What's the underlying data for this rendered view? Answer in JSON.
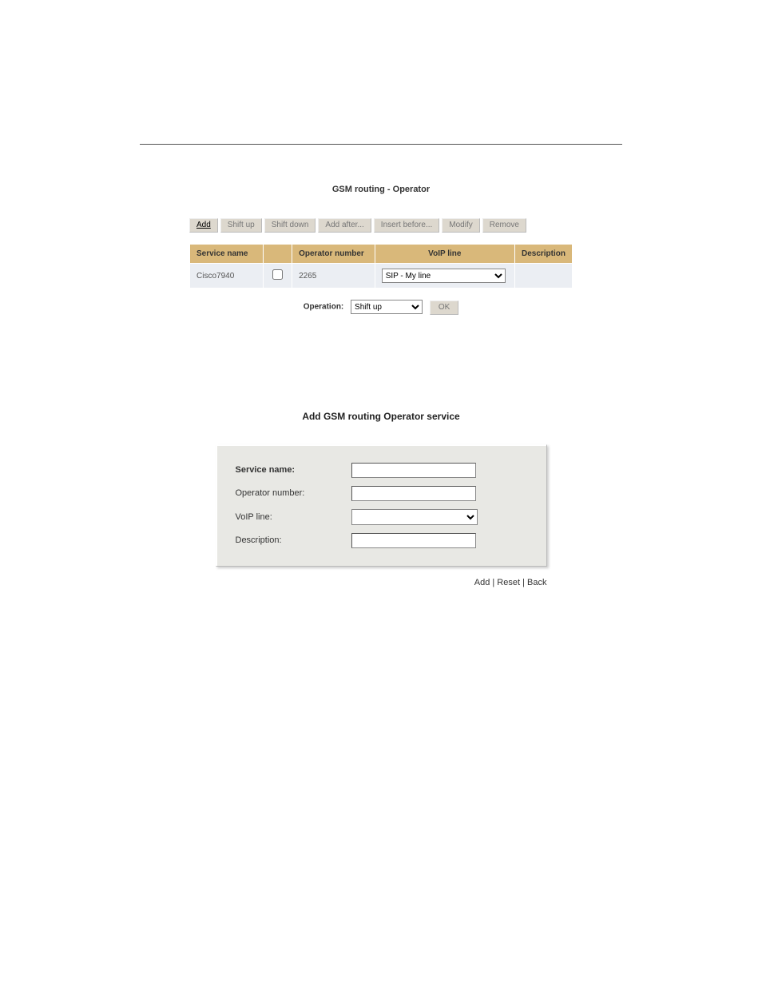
{
  "panel1": {
    "title": "GSM routing - Operator",
    "toolbar": {
      "add": "Add",
      "shift_up": "Shift up",
      "shift_down": "Shift down",
      "add_after": "Add after...",
      "insert_before": "Insert before...",
      "modify": "Modify",
      "remove": "Remove"
    },
    "columns": {
      "service_name": "Service name",
      "operator_number": "Operator number",
      "voip_line": "VoIP line",
      "description": "Description"
    },
    "rows": [
      {
        "service_name": "Cisco7940",
        "checked": false,
        "operator_number": "2265",
        "voip_line_selected": "SIP - My line",
        "description": ""
      }
    ],
    "operation": {
      "label": "Operation:",
      "selected": "Shift up",
      "ok": "OK"
    }
  },
  "panel2": {
    "title": "Add GSM routing Operator service",
    "fields": {
      "service_name_label": "Service name:",
      "service_name_value": "",
      "operator_number_label": "Operator number:",
      "operator_number_value": "",
      "voip_line_label": "VoIP line:",
      "voip_line_value": "",
      "description_label": "Description:",
      "description_value": ""
    },
    "links": {
      "add": "Add",
      "reset": "Reset",
      "back": "Back",
      "sep": " | "
    }
  }
}
